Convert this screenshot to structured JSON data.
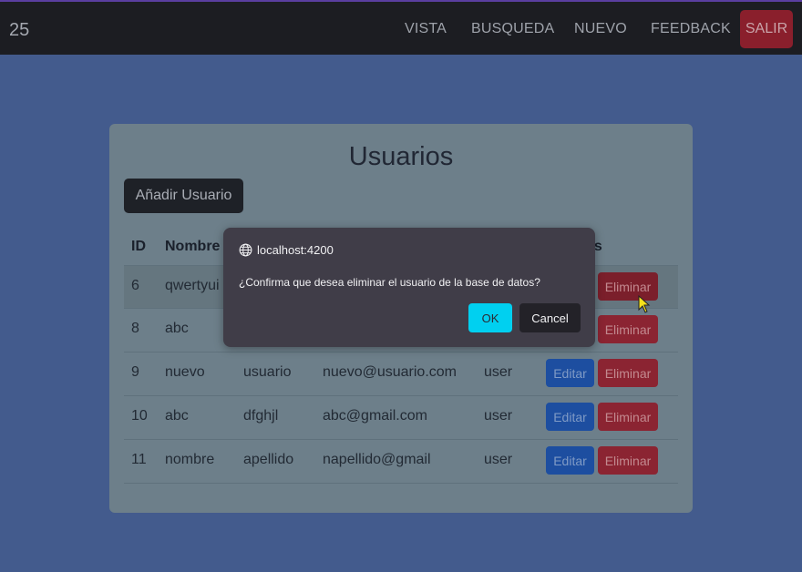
{
  "navbar": {
    "brand": "25",
    "links": [
      "VISTA",
      "BUSQUEDA",
      "NUEVO",
      "FEEDBACK"
    ],
    "logout_label": "SALIR"
  },
  "card": {
    "title": "Usuarios",
    "add_button": "Añadir Usuario"
  },
  "table": {
    "headers": [
      "ID",
      "Nombre",
      "es"
    ],
    "rows": [
      {
        "id": "6",
        "nombre": "qwertyui",
        "apellido": "",
        "email": "",
        "rol": "",
        "delete": "Eliminar"
      },
      {
        "id": "8",
        "nombre": "abc",
        "apellido": "",
        "email": "",
        "rol": "",
        "delete": "Eliminar"
      },
      {
        "id": "9",
        "nombre": "nuevo",
        "apellido": "usuario",
        "email": "nuevo@usuario.com",
        "rol": "user",
        "edit": "Editar",
        "delete": "Eliminar"
      },
      {
        "id": "10",
        "nombre": "abc",
        "apellido": "dfghjl",
        "email": "abc@gmail.com",
        "rol": "user",
        "edit": "Editar",
        "delete": "Eliminar"
      },
      {
        "id": "11",
        "nombre": "nombre",
        "apellido": "apellido",
        "email": "napellido@gmail",
        "rol": "user",
        "edit": "Editar",
        "delete": "Eliminar"
      }
    ]
  },
  "dialog": {
    "origin": "localhost:4200",
    "message": "¿Confirma que desea eliminar el usuario de la base de datos?",
    "ok_label": "OK",
    "cancel_label": "Cancel"
  },
  "colors": {
    "page_bg": "#435b8d",
    "navbar_bg": "#1c1d22",
    "danger": "#8b2432",
    "primary": "#1d4ea0",
    "dialog_ok": "#00d0f0"
  }
}
